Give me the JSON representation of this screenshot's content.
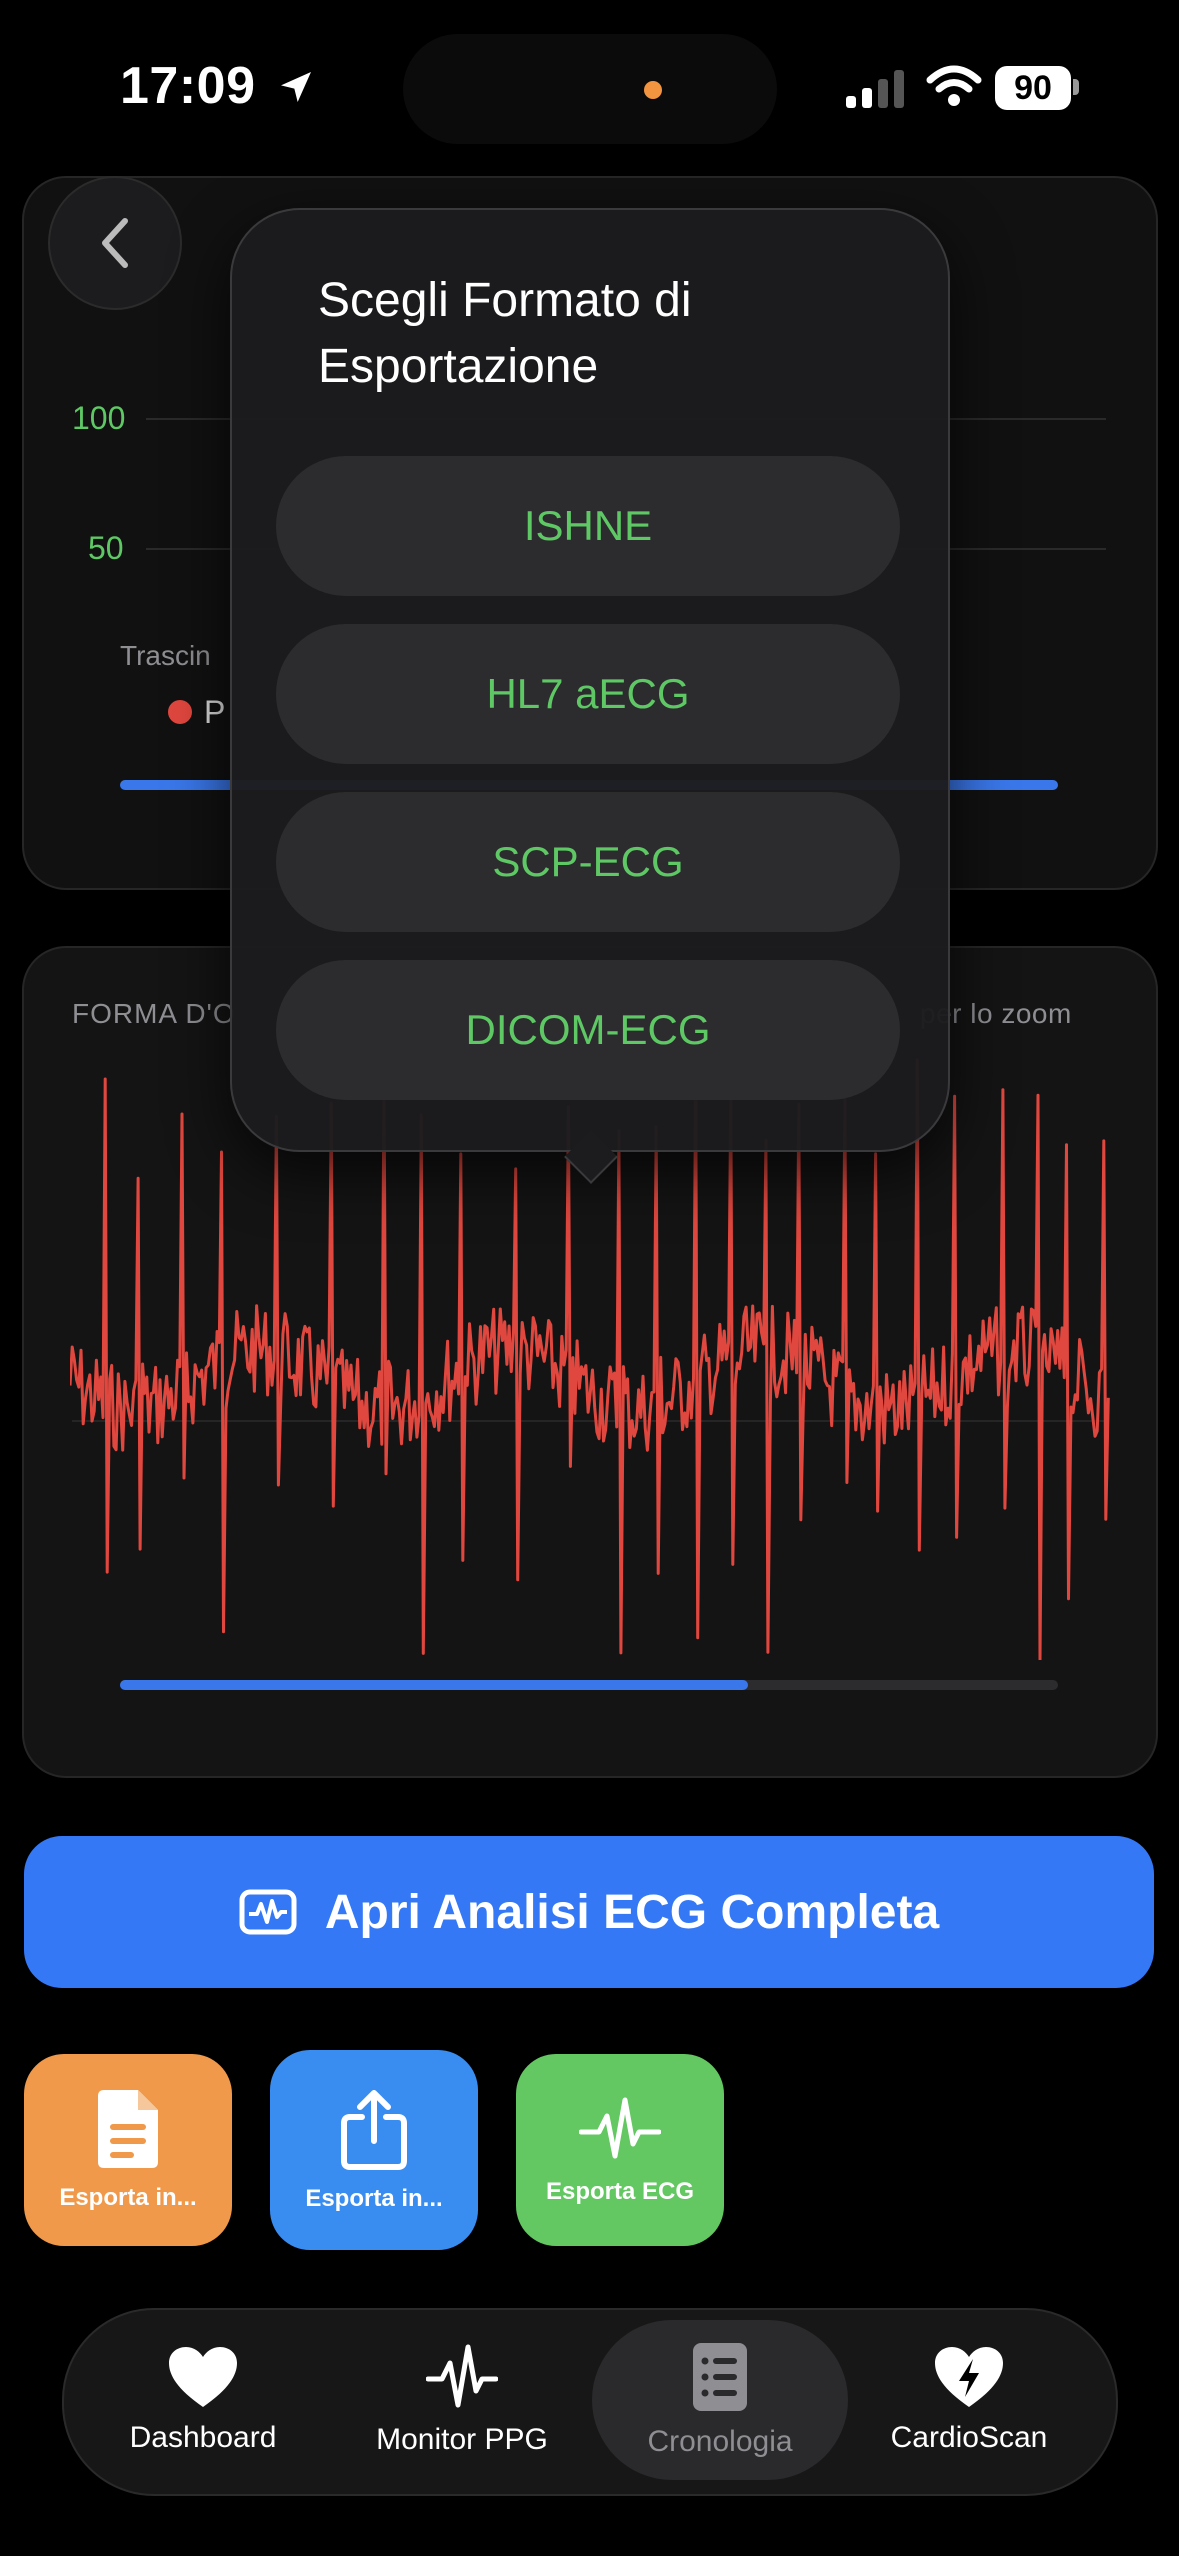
{
  "status_bar": {
    "time": "17:09",
    "battery": "90"
  },
  "chart_top": {
    "y_labels": [
      "100",
      "50"
    ],
    "hint": "Trascin",
    "legend_label": "P"
  },
  "ecg_card": {
    "title_left": "FORMA D'O",
    "title_right": "per lo zoom",
    "scroll_progress": 0.67
  },
  "popup": {
    "title": "Scegli Formato di Esportazione",
    "options": [
      "ISHNE",
      "HL7 aECG",
      "SCP-ECG",
      "DICOM-ECG"
    ]
  },
  "cta": {
    "label": "Apri Analisi ECG Completa"
  },
  "actions": [
    {
      "label": "Esporta in...",
      "color": "#f0994a"
    },
    {
      "label": "Esporta in...",
      "color": "#3a8df0"
    },
    {
      "label": "Esporta ECG",
      "color": "#63c862"
    }
  ],
  "tabs": [
    {
      "label": "Dashboard",
      "icon": "heart-icon"
    },
    {
      "label": "Monitor PPG",
      "icon": "waveform-icon"
    },
    {
      "label": "Cronologia",
      "icon": "list-icon",
      "active": true
    },
    {
      "label": "CardioScan",
      "icon": "heart-bolt-icon"
    }
  ],
  "colors": {
    "accent_green": "#5ec865",
    "accent_blue": "#3478f6",
    "ecg_red": "#e0473e"
  }
}
